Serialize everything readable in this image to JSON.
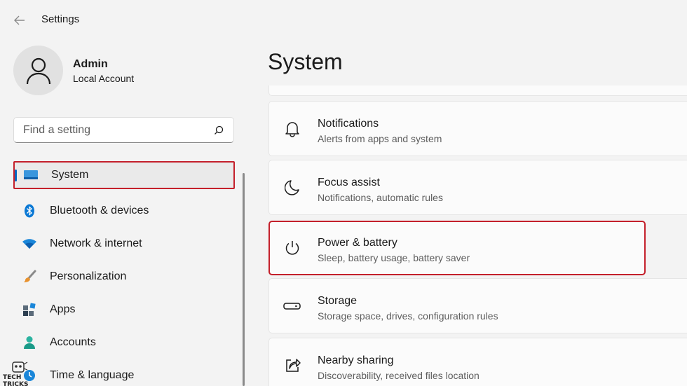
{
  "window": {
    "title": "Settings"
  },
  "profile": {
    "name": "Admin",
    "account_type": "Local Account"
  },
  "search": {
    "placeholder": "Find a setting"
  },
  "sidebar": {
    "items": [
      {
        "label": "System",
        "icon": "monitor-icon",
        "active": true
      },
      {
        "label": "Bluetooth & devices",
        "icon": "bluetooth-icon"
      },
      {
        "label": "Network & internet",
        "icon": "wifi-icon"
      },
      {
        "label": "Personalization",
        "icon": "brush-icon"
      },
      {
        "label": "Apps",
        "icon": "apps-icon"
      },
      {
        "label": "Accounts",
        "icon": "person-icon"
      },
      {
        "label": "Time & language",
        "icon": "globe-clock-icon"
      }
    ]
  },
  "main": {
    "title": "System",
    "cards": [
      {
        "title": "Notifications",
        "subtitle": "Alerts from apps and system",
        "icon": "bell-icon"
      },
      {
        "title": "Focus assist",
        "subtitle": "Notifications, automatic rules",
        "icon": "moon-icon"
      },
      {
        "title": "Power & battery",
        "subtitle": "Sleep, battery usage, battery saver",
        "icon": "power-icon",
        "highlighted": true
      },
      {
        "title": "Storage",
        "subtitle": "Storage space, drives, configuration rules",
        "icon": "drive-icon"
      },
      {
        "title": "Nearby sharing",
        "subtitle": "Discoverability, received files location",
        "icon": "share-icon"
      }
    ]
  },
  "watermark": {
    "text": "TECH TRICKS"
  },
  "colors": {
    "accent": "#0067c0",
    "highlight": "#c4202b"
  }
}
